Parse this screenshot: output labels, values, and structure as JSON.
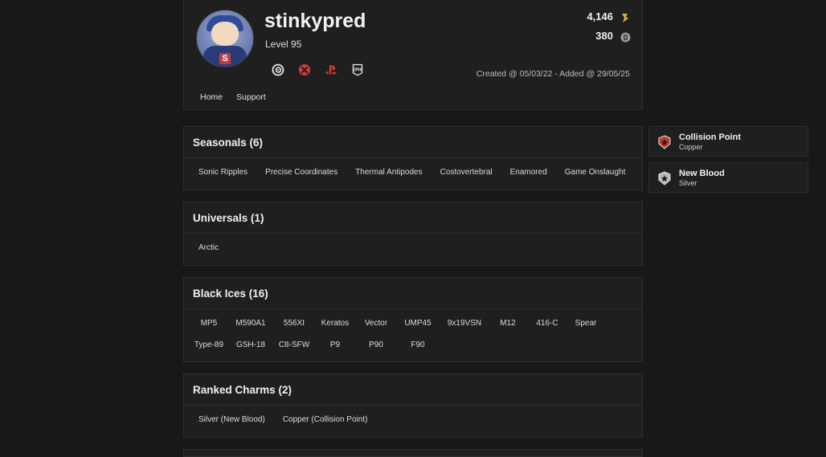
{
  "profile": {
    "username": "stinkypred",
    "level": "Level 95",
    "created": "Created @ 05/03/22 - Added @ 29/05/25",
    "stats": [
      {
        "value": "4,146",
        "icon": "renown-icon"
      },
      {
        "value": "380",
        "icon": "r6-credits-icon"
      }
    ],
    "platforms": [
      "ubisoft-icon",
      "xbox-icon",
      "playstation-icon",
      "epic-games-icon"
    ],
    "nav": [
      "Home",
      "Support"
    ]
  },
  "sections": [
    {
      "title": "Seasonals (6)",
      "items": [
        "Sonic Ripples",
        "Precise Coordinates",
        "Thermal Antipodes",
        "Costovertebral",
        "Enamored",
        "Game Onslaught"
      ]
    },
    {
      "title": "Universals (1)",
      "items": [
        "Arctic"
      ]
    },
    {
      "title": "Black Ices (16)",
      "items": [
        "MP5",
        "M590A1",
        "556XI",
        "Keratos",
        "Vector",
        "UMP45",
        "9x19VSN",
        "M12",
        "416-C",
        "Spear",
        "Type-89",
        "GSH-18",
        "C8-SFW",
        "P9",
        "P90",
        "F90"
      ]
    },
    {
      "title": "Ranked Charms (2)",
      "items": [
        "Silver (New Blood)",
        "Copper (Collision Point)"
      ]
    }
  ],
  "ranks": [
    {
      "name": "Collision Point",
      "tier": "Copper",
      "color": "#c0392b"
    },
    {
      "name": "New Blood",
      "tier": "Silver",
      "color": "#b8b8b8"
    }
  ]
}
